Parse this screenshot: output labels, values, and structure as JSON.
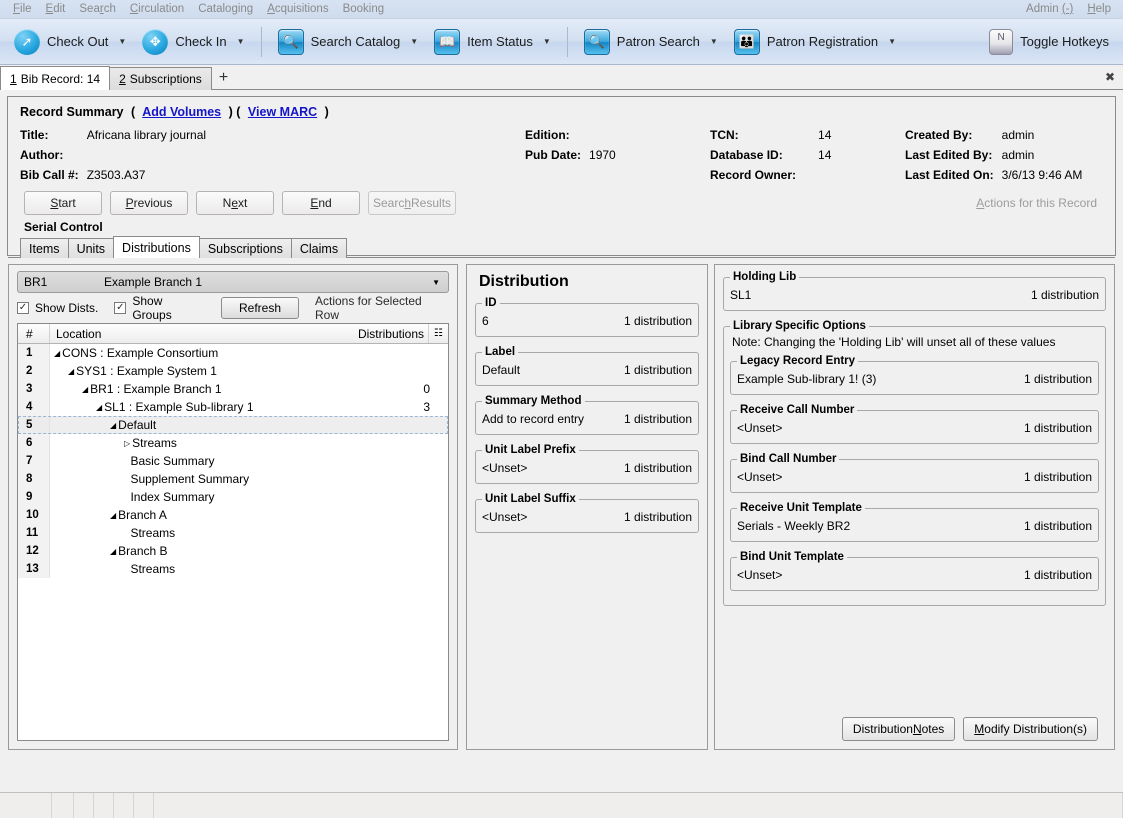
{
  "menubar": {
    "items": [
      "File",
      "Edit",
      "Search",
      "Circulation",
      "Cataloging",
      "Acquisitions",
      "Booking"
    ],
    "right": [
      "Admin (-)",
      "Help"
    ]
  },
  "toolbar": {
    "buttons": [
      {
        "label": "Check Out",
        "icon": "check-out-icon"
      },
      {
        "label": "Check In",
        "icon": "check-in-icon"
      },
      {
        "label": "Search Catalog",
        "icon": "search-catalog-icon"
      },
      {
        "label": "Item Status",
        "icon": "item-status-icon"
      },
      {
        "label": "Patron Search",
        "icon": "patron-search-icon"
      },
      {
        "label": "Patron Registration",
        "icon": "patron-registration-icon"
      }
    ],
    "hotkeys_label": "Toggle Hotkeys",
    "hotkeys_icon_glyph": "N"
  },
  "window_tabs": {
    "tabs": [
      {
        "num": "1",
        "label": "Bib Record: 14",
        "active": true
      },
      {
        "num": "2",
        "label": "Subscriptions",
        "active": false
      }
    ],
    "add_label": "+",
    "close_label": "✖"
  },
  "record_summary": {
    "heading": "Record Summary",
    "paren_open": "(",
    "add_volumes": "Add Volumes",
    "paren_mid": ") (",
    "view_marc": "View MARC",
    "paren_close": ")",
    "fields": {
      "col1": [
        {
          "key": "Title:",
          "value": "Africana library journal"
        },
        {
          "key": "Author:",
          "value": ""
        },
        {
          "key": "Bib Call #:",
          "value": "Z3503.A37"
        }
      ],
      "col2": [
        {
          "key": "Edition:",
          "value": ""
        },
        {
          "key": "Pub Date:",
          "value": "1970"
        },
        {
          "key": "",
          "value": ""
        }
      ],
      "col3": [
        {
          "key": "TCN:",
          "value": "14"
        },
        {
          "key": "Database ID:",
          "value": "14"
        },
        {
          "key": "Record Owner:",
          "value": ""
        }
      ],
      "col4": [
        {
          "key": "Created By:",
          "value": "admin"
        },
        {
          "key": "Last Edited By:",
          "value": "admin"
        },
        {
          "key": "Last Edited On:",
          "value": "3/6/13 9:46 AM"
        }
      ]
    }
  },
  "nav": {
    "buttons": [
      "Start",
      "Previous",
      "Next",
      "End"
    ],
    "search_results": "Search Results",
    "actions_for_record": "Actions for this Record"
  },
  "serial_control": {
    "heading": "Serial Control",
    "tabs": [
      {
        "label": "Items",
        "active": false
      },
      {
        "label": "Units",
        "active": false
      },
      {
        "label": "Distributions",
        "active": true
      },
      {
        "label": "Subscriptions",
        "active": false
      },
      {
        "label": "Claims",
        "active": false
      }
    ]
  },
  "left_panel": {
    "org_select": {
      "code": "BR1",
      "name": "Example Branch 1"
    },
    "show_dists": {
      "label": "Show Dists.",
      "checked": true
    },
    "show_groups": {
      "label": "Show Groups",
      "checked": true
    },
    "refresh_label": "Refresh",
    "actions_for_selected_row": "Actions for Selected Row",
    "columns": [
      "#",
      "Location",
      "Distributions"
    ],
    "rows": [
      {
        "num": "1",
        "indent": 0,
        "tri": "expanded",
        "location": "CONS : Example Consortium",
        "dist": "",
        "selected": false
      },
      {
        "num": "2",
        "indent": 1,
        "tri": "expanded",
        "location": "SYS1 : Example System 1",
        "dist": "",
        "selected": false
      },
      {
        "num": "3",
        "indent": 2,
        "tri": "expanded",
        "location": "BR1 : Example Branch 1",
        "dist": "0",
        "selected": false
      },
      {
        "num": "4",
        "indent": 3,
        "tri": "expanded",
        "location": "SL1 : Example Sub-library 1",
        "dist": "3",
        "selected": false
      },
      {
        "num": "5",
        "indent": 4,
        "tri": "expanded",
        "location": "Default",
        "dist": "",
        "selected": true
      },
      {
        "num": "6",
        "indent": 5,
        "tri": "collapsed",
        "location": "Streams",
        "dist": "",
        "selected": false
      },
      {
        "num": "7",
        "indent": 5,
        "tri": "none",
        "location": "Basic Summary",
        "dist": "",
        "selected": false
      },
      {
        "num": "8",
        "indent": 5,
        "tri": "none",
        "location": "Supplement Summary",
        "dist": "",
        "selected": false
      },
      {
        "num": "9",
        "indent": 5,
        "tri": "none",
        "location": "Index Summary",
        "dist": "",
        "selected": false
      },
      {
        "num": "10",
        "indent": 4,
        "tri": "expanded",
        "location": "Branch A",
        "dist": "",
        "selected": false
      },
      {
        "num": "11",
        "indent": 5,
        "tri": "none",
        "location": "Streams",
        "dist": "",
        "selected": false
      },
      {
        "num": "12",
        "indent": 4,
        "tri": "expanded",
        "location": "Branch B",
        "dist": "",
        "selected": false
      },
      {
        "num": "13",
        "indent": 5,
        "tri": "none",
        "location": "Streams",
        "dist": "",
        "selected": false
      }
    ]
  },
  "middle_panel": {
    "title": "Distribution",
    "fields": [
      {
        "legend": "ID",
        "value": "6",
        "count": "1 distribution"
      },
      {
        "legend": "Label",
        "value": "Default",
        "count": "1 distribution"
      },
      {
        "legend": "Summary Method",
        "value": "Add to record entry",
        "count": "1 distribution"
      },
      {
        "legend": "Unit Label Prefix",
        "value": "<Unset>",
        "count": "1 distribution"
      },
      {
        "legend": "Unit Label Suffix",
        "value": "<Unset>",
        "count": "1 distribution"
      }
    ]
  },
  "right_panel": {
    "holding_lib": {
      "legend": "Holding Lib",
      "value": "SL1",
      "count": "1 distribution"
    },
    "lib_specific": {
      "legend": "Library Specific Options",
      "note": "Note: Changing the 'Holding Lib' will unset all of these values",
      "fields": [
        {
          "legend": "Legacy Record Entry",
          "value": "Example Sub-library 1! (3)",
          "count": "1 distribution"
        },
        {
          "legend": "Receive Call Number",
          "value": "<Unset>",
          "count": "1 distribution"
        },
        {
          "legend": "Bind Call Number",
          "value": "<Unset>",
          "count": "1 distribution"
        },
        {
          "legend": "Receive Unit Template",
          "value": "Serials - Weekly BR2",
          "count": "1 distribution"
        },
        {
          "legend": "Bind Unit Template",
          "value": "<Unset>",
          "count": "1 distribution"
        }
      ]
    },
    "buttons": [
      {
        "label": "Distribution Notes",
        "mnemonic": "N"
      },
      {
        "label": "Modify Distribution(s)",
        "mnemonic": "M"
      }
    ]
  },
  "status_bar": {
    "segments": [
      "",
      "",
      "",
      "",
      "",
      "",
      ""
    ]
  },
  "colors": {
    "link": "#1414c8",
    "toolbar_top": "#e3ecf8",
    "toolbar_bottom": "#dbe6f6",
    "menubar_text": "#8a8a8a",
    "panel_bg": "#f0f0f0",
    "selection_bg": "#eeeeee"
  }
}
